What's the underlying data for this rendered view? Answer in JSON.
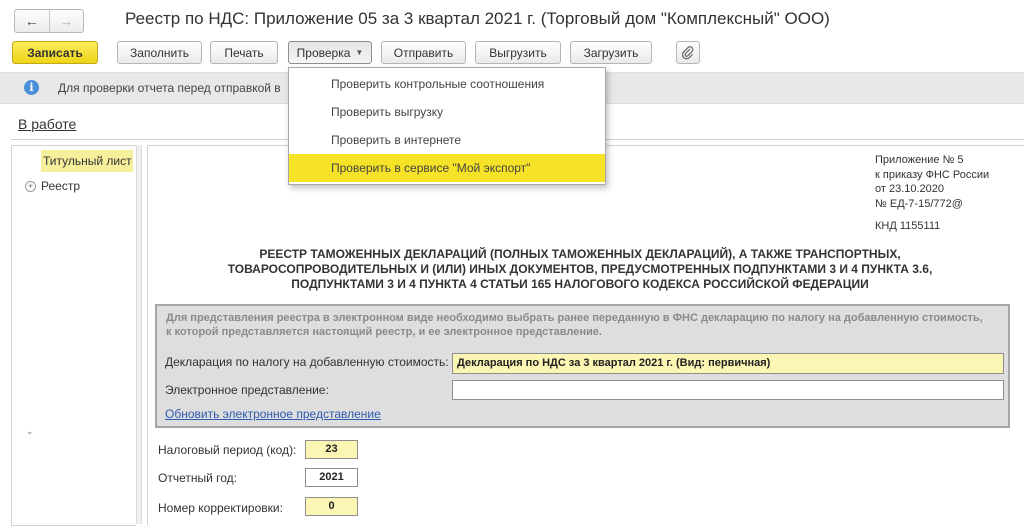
{
  "window": {
    "title": "Реестр по НДС: Приложение 05 за 3 квартал 2021 г. (Торговый дом \"Комплексный\" ООО)"
  },
  "nav": {
    "back": "←",
    "forward": "→"
  },
  "toolbar": {
    "save": "Записать",
    "fill": "Заполнить",
    "print": "Печать",
    "check": "Проверка",
    "send": "Отправить",
    "export": "Выгрузить",
    "import": "Загрузить",
    "attach_icon": "paperclip-icon"
  },
  "check_menu": {
    "items": [
      "Проверить контрольные соотношения",
      "Проверить выгрузку",
      "Проверить в интернете",
      "Проверить в сервисе \"Мой экспорт\""
    ]
  },
  "info_bar": {
    "icon": "info-icon",
    "text": "Для проверки отчета перед отправкой в"
  },
  "status": "В работе",
  "tree": {
    "items": [
      "Титульный лист",
      "Реестр"
    ]
  },
  "document": {
    "appendix": {
      "line1": "Приложение № 5",
      "line2": "к приказу ФНС России",
      "line3": "от 23.10.2020",
      "line4": "№ ЕД-7-15/772@"
    },
    "knd": "КНД 1155111",
    "heading": {
      "line1": "РЕЕСТР ТАМОЖЕННЫХ ДЕКЛАРАЦИЙ (ПОЛНЫХ ТАМОЖЕННЫХ ДЕКЛАРАЦИЙ), А ТАКЖЕ ТРАНСПОРТНЫХ,",
      "line2": "ТОВАРОСОПРОВОДИТЕЛЬНЫХ И (ИЛИ) ИНЫХ ДОКУМЕНТОВ, ПРЕДУСМОТРЕННЫХ ПОДПУНКТАМИ 3 И 4 ПУНКТА 3.6,",
      "line3": "ПОДПУНКТАМИ 3 И 4 ПУНКТА 4 СТАТЬИ 165 НАЛОГОВОГО КОДЕКСА РОССИЙСКОЙ ФЕДЕРАЦИИ"
    },
    "note": {
      "line1": "Для представления реестра в электронном виде необходимо выбрать ранее переданную в ФНС декларацию по налогу на добавленную стоимость,",
      "line2": "к которой представляется настоящий реестр, и ее электронное представление."
    },
    "declaration_label": "Декларация по налогу на добавленную стоимость:",
    "declaration_value": "Декларация по НДС за 3 квартал 2021 г. (Вид: первичная)",
    "electronic_label": "Электронное представление:",
    "electronic_value": "",
    "refresh_link": "Обновить электронное представление",
    "tax_period_label": "Налоговый период (код):",
    "tax_period_value": "23",
    "year_label": "Отчетный год:",
    "year_value": "2021",
    "correction_label": "Номер корректировки:",
    "correction_value": "0"
  }
}
